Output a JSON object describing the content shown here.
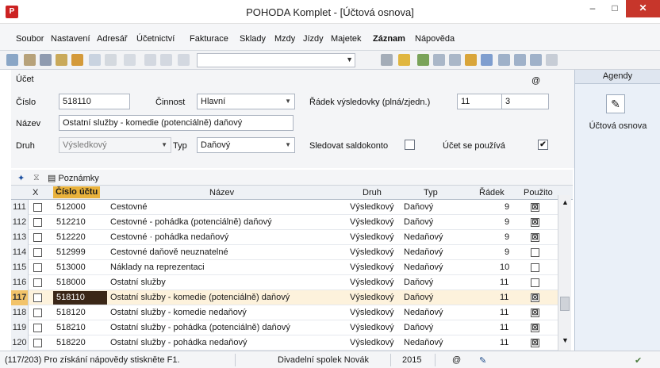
{
  "window": {
    "title": "POHODA Komplet - [Účtová osnova]",
    "app_icon": "pohoda-logo",
    "min": "–",
    "max": "□",
    "close": "✕"
  },
  "menu": [
    "Soubor",
    "Nastavení",
    "Adresář",
    "Účetnictví",
    "Fakturace",
    "Sklady",
    "Mzdy",
    "Jízdy",
    "Majetek",
    "Záznam",
    "Nápověda"
  ],
  "toolbar": {
    "combo_value": ""
  },
  "form": {
    "section": "Účet",
    "at_sign": "@",
    "cislo_label": "Číslo",
    "cislo": "518110",
    "cinnost_label": "Činnost",
    "cinnost": "Hlavní",
    "nazev_label": "Název",
    "nazev": "Ostatní služby - komedie  (potenciálně) daňový",
    "druh_label": "Druh",
    "druh": "Výsledkový",
    "typ_label": "Typ",
    "typ": "Daňový",
    "radek_label": "Řádek výsledovky (plná/zjedn.)",
    "radek_plna": "11",
    "radek_zjedn": "3",
    "saldo_label": "Sledovat saldokonto",
    "saldo_checked": "",
    "pouziva_label": "Účet se používá",
    "pouziva_checked": "✔"
  },
  "agendy": {
    "header": "Agendy",
    "item": "Účtová osnova"
  },
  "grid_toolbar": {
    "tab_label": "Poznámky"
  },
  "columns": {
    "x": "X",
    "cislo": "Číslo účtu",
    "nazev": "Název",
    "druh": "Druh",
    "typ": "Typ",
    "radek": "Řádek",
    "pouzito": "Použito"
  },
  "rows": [
    {
      "n": "111",
      "cislo": "512000",
      "nazev": "Cestovné",
      "druh": "Výsledkový",
      "typ": "Daňový",
      "radek": "9",
      "pouzito": "☒"
    },
    {
      "n": "112",
      "cislo": "512210",
      "nazev": "Cestovné - pohádka    (potenciálně) daňový",
      "druh": "Výsledkový",
      "typ": "Daňový",
      "radek": "9",
      "pouzito": "☒"
    },
    {
      "n": "113",
      "cislo": "512220",
      "nazev": "Cestovné · pohádka    nedaňový",
      "druh": "Výsledkový",
      "typ": "Nedaňový",
      "radek": "9",
      "pouzito": "☒"
    },
    {
      "n": "114",
      "cislo": "512999",
      "nazev": "Cestovné daňově neuznatelné",
      "druh": "Výsledkový",
      "typ": "Nedaňový",
      "radek": "9",
      "pouzito": ""
    },
    {
      "n": "115",
      "cislo": "513000",
      "nazev": "Náklady na reprezentaci",
      "druh": "Výsledkový",
      "typ": "Nedaňový",
      "radek": "10",
      "pouzito": ""
    },
    {
      "n": "116",
      "cislo": "518000",
      "nazev": "Ostatní služby",
      "druh": "Výsledkový",
      "typ": "Daňový",
      "radek": "11",
      "pouzito": ""
    },
    {
      "n": "117",
      "cislo": "518110",
      "nazev": "Ostatní služby - komedie  (potenciálně) daňový",
      "druh": "Výsledkový",
      "typ": "Daňový",
      "radek": "11",
      "pouzito": "☒"
    },
    {
      "n": "118",
      "cislo": "518120",
      "nazev": "Ostatní služby - komedie  nedaňový",
      "druh": "Výsledkový",
      "typ": "Nedaňový",
      "radek": "11",
      "pouzito": "☒"
    },
    {
      "n": "119",
      "cislo": "518210",
      "nazev": "Ostatní služby - pohádka  (potenciálně) daňový",
      "druh": "Výsledkový",
      "typ": "Daňový",
      "radek": "11",
      "pouzito": "☒"
    },
    {
      "n": "120",
      "cislo": "518220",
      "nazev": "Ostatní služby - pohádka  nedaňový",
      "druh": "Výsledkový",
      "typ": "Nedaňový",
      "radek": "11",
      "pouzito": "☒"
    }
  ],
  "status": {
    "help": "(117/203) Pro získání nápovědy stiskněte F1.",
    "company": "Divadelní spolek Novák",
    "year": "2015",
    "at": "@"
  }
}
